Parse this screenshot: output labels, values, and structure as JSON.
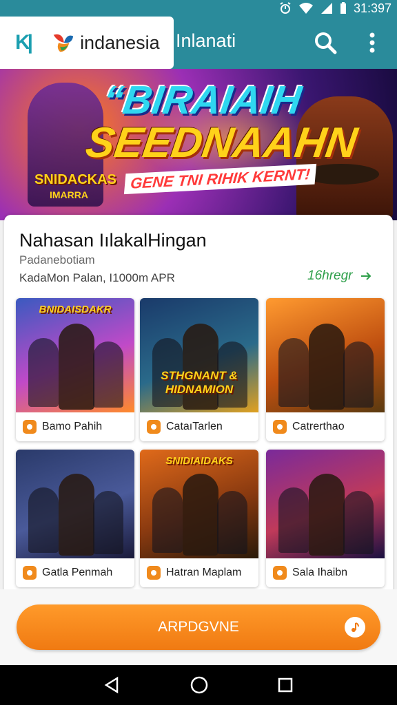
{
  "status_bar": {
    "time": "31:397"
  },
  "app_bar": {
    "brand": "indanesia",
    "title": "Inlanati",
    "logo_mark": "K"
  },
  "banner": {
    "headline_line1": "“BIRAIAIH",
    "headline_line2": "SEEDNAAHN",
    "tagline": "GENE TNI RIHIK KERNT!",
    "logo_line1": "SNIDACKAS",
    "logo_line2": "IMARRA"
  },
  "section": {
    "title": "Nahasan IılakalHingan",
    "subtitle1": "Padanebotiam",
    "subtitle2": "KadaMon Palan, I1000m APR",
    "more_link": "16hregr"
  },
  "games": [
    {
      "name": "Bamo Pahih",
      "art_text": "BNIDAISDAKR",
      "colors": [
        "#3a5ac0",
        "#c04ac8",
        "#ff8a2a"
      ]
    },
    {
      "name": "CataıTarlen",
      "art_text": "STHGNANT & HIDNAMION",
      "colors": [
        "#1a3a6a",
        "#2a6a8a",
        "#e0a020"
      ]
    },
    {
      "name": "Catrerthao",
      "art_text": "",
      "colors": [
        "#ff9a30",
        "#c05010",
        "#5a3a10"
      ]
    },
    {
      "name": "Gatla Penmah",
      "art_text": "",
      "colors": [
        "#2a3a6a",
        "#4a5a9a",
        "#1a1a3a"
      ]
    },
    {
      "name": "Hatran Maplam",
      "art_text": "SNIDIAIDAKS",
      "colors": [
        "#e06a1a",
        "#8a3a10",
        "#2a1a0a"
      ]
    },
    {
      "name": "Sala Ihaibn",
      "art_text": "",
      "colors": [
        "#7a2a9a",
        "#c03a5a",
        "#1a1040"
      ]
    }
  ],
  "cta": {
    "label": "ARPDGVNE"
  },
  "colors": {
    "primary": "#2a8b9b",
    "accent": "#f08a1c",
    "link": "#2e9f4a"
  }
}
